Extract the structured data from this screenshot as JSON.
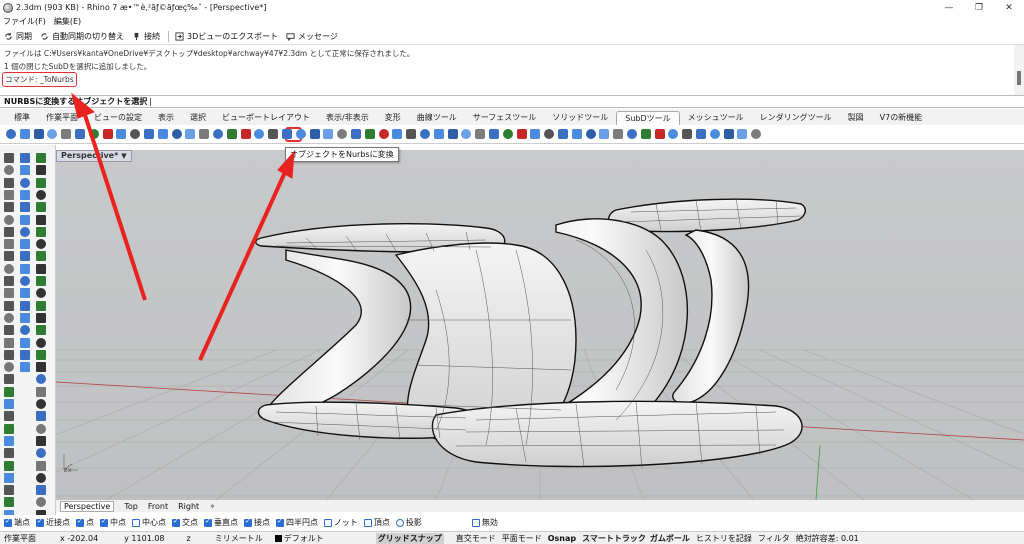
{
  "window": {
    "title": "2.3dm (903 KB) - Rhino 7 æ•™è‚²ãƒ©ãƒœç‰ˆ - [Perspective*]",
    "controls": [
      "minimize",
      "restore",
      "close"
    ]
  },
  "menu": [
    "ファイル(F)",
    "編集(E)"
  ],
  "toolbar": [
    {
      "label": "同期",
      "icon": "sync-icon"
    },
    {
      "label": "自動同期の切り替え",
      "icon": "auto-sync-icon"
    },
    {
      "label": "接続",
      "icon": "connect-icon"
    },
    {
      "label": "3Dビューのエクスポート",
      "icon": "export-3d-icon"
    },
    {
      "label": "メッセージ",
      "icon": "message-icon"
    }
  ],
  "history": {
    "line1": "ファイルは C:¥Users¥kanta¥OneDrive¥デスクトップ¥desktop¥archway¥47¥2.3dm として正常に保存されました。",
    "line2": "1 個の閉じたSubDを選択に追加しました。",
    "command": "コマンド: _ToNurbs"
  },
  "prompt": "NURBSに変換するオブジェクトを選択",
  "tabs": [
    "標準",
    "作業平面",
    "ビューの設定",
    "表示",
    "選択",
    "ビューポートレイアウト",
    "表示/非表示",
    "変形",
    "曲線ツール",
    "サーフェスツール",
    "ソリッドツール",
    "SubDツール",
    "メッシュツール",
    "レンダリングツール",
    "製図",
    "V7の新機能"
  ],
  "active_tab": "SubDツール",
  "tooltip": "オブジェクトをNurbsに変換",
  "viewport": {
    "title": "Perspective*",
    "tabs": [
      "Perspective",
      "Top",
      "Front",
      "Right"
    ],
    "active_tab": "Perspective"
  },
  "osnap": [
    {
      "label": "端点",
      "checked": true
    },
    {
      "label": "近接点",
      "checked": true
    },
    {
      "label": "点",
      "checked": true
    },
    {
      "label": "中点",
      "checked": true
    },
    {
      "label": "中心点",
      "checked": false
    },
    {
      "label": "交点",
      "checked": true
    },
    {
      "label": "垂直点",
      "checked": true
    },
    {
      "label": "接点",
      "checked": true
    },
    {
      "label": "四半円点",
      "checked": true
    },
    {
      "label": "ノット",
      "checked": false
    },
    {
      "label": "頂点",
      "checked": false
    },
    {
      "label": "投影",
      "checked": false
    },
    {
      "label": "無効",
      "checked": false
    }
  ],
  "status": {
    "cplane": "作業平面",
    "x": "x -202.04",
    "y": "y 1101.08",
    "z": "z",
    "unit": "ミリメートル",
    "layer": "デフォルト",
    "grid_snap": "グリッドスナップ",
    "ortho": "直交モード",
    "planar": "平面モード",
    "osnap": "Osnap",
    "smart_track": "スマートトラック",
    "gumball": "ガムボール",
    "history": "ヒストリを記録",
    "filter": "フィルタ",
    "tolerance": "絶対許容差: 0.01"
  },
  "colors": {
    "highlight": "#e53030",
    "viewport_bg": "#c4c5c6",
    "checkbox": "#2a6fd6"
  }
}
